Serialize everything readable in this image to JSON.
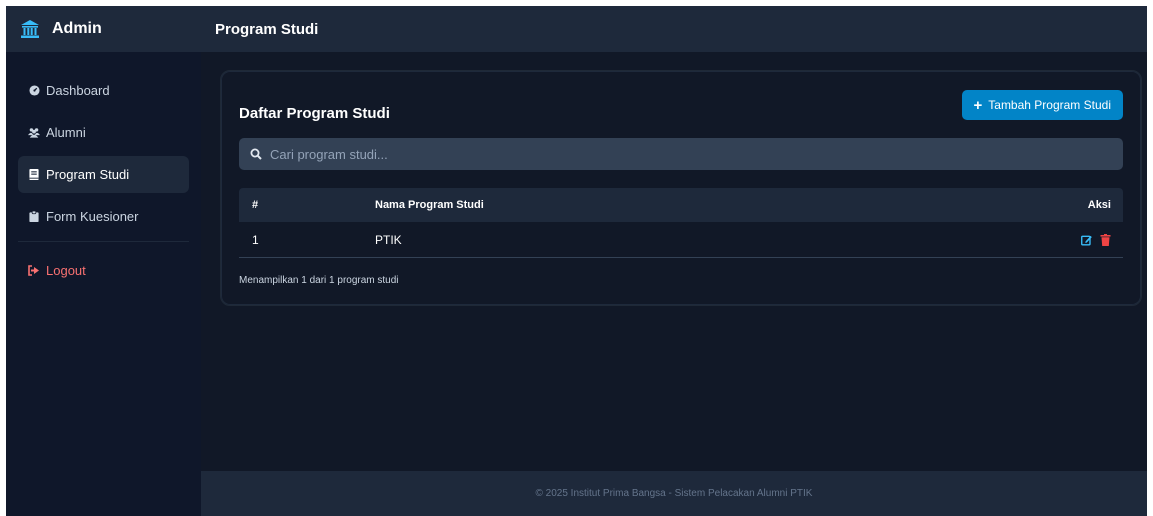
{
  "sidebar": {
    "brand": "Admin",
    "brand_icon": "institution-icon",
    "items": [
      {
        "label": "Dashboard",
        "icon": "gauge-icon"
      },
      {
        "label": "Alumni",
        "icon": "users-icon"
      },
      {
        "label": "Program Studi",
        "icon": "book-icon",
        "active": true
      },
      {
        "label": "Form Kuesioner",
        "icon": "clipboard-icon"
      }
    ],
    "logout": {
      "label": "Logout",
      "icon": "sign-out-icon"
    }
  },
  "header": {
    "title": "Program Studi"
  },
  "card": {
    "title": "Daftar Program Studi",
    "add_button": "Tambah Program Studi",
    "search_placeholder": "Cari program studi...",
    "table": {
      "columns": [
        "#",
        "Nama Program Studi",
        "Aksi"
      ],
      "rows": [
        {
          "no": "1",
          "nama": "PTIK",
          "actions": [
            "edit-icon",
            "trash-icon"
          ]
        }
      ]
    },
    "summary": "Menampilkan 1 dari 1 program studi"
  },
  "footer": {
    "text": "© 2025 Institut Prima Bangsa - Sistem Pelacakan Alumni PTIK"
  },
  "colors": {
    "sidebar_bg": "#0f172a",
    "header_bg": "#1e293b",
    "accent": "#0284c7",
    "edit": "#38bdf8",
    "delete": "#ef4444",
    "logout": "#f87171"
  }
}
